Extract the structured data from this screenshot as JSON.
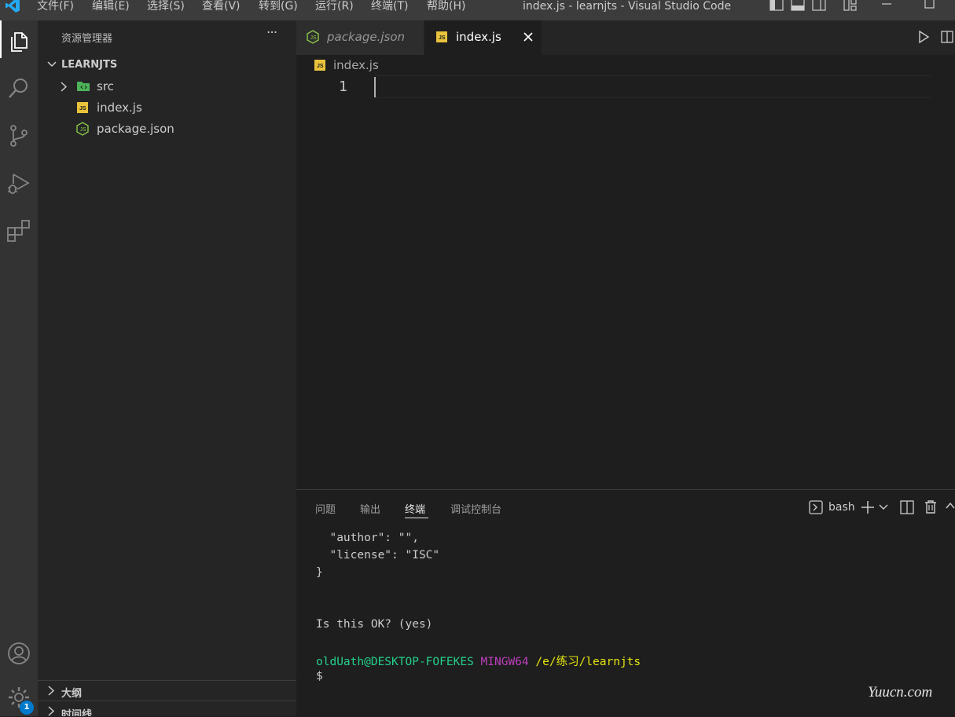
{
  "titlebar": {
    "menu": [
      "文件(F)",
      "编辑(E)",
      "选择(S)",
      "查看(V)",
      "转到(G)",
      "运行(R)",
      "终端(T)",
      "帮助(H)"
    ],
    "title": "index.js - learnjts - Visual Studio Code"
  },
  "activity_bar": {
    "items": [
      "explorer-icon",
      "search-icon",
      "source-control-icon",
      "run-debug-icon",
      "extensions-icon"
    ],
    "bottom": [
      "account-icon",
      "manage-gear-icon"
    ],
    "badge": "1"
  },
  "sidebar": {
    "title": "资源管理器",
    "more": "···",
    "root": "LEARNJTS",
    "items": [
      {
        "label": "src",
        "icon": "folder-icon"
      },
      {
        "label": "index.js",
        "icon": "js-file-icon"
      },
      {
        "label": "package.json",
        "icon": "node-json-icon"
      }
    ],
    "outline": "大纲",
    "timeline": "时间线"
  },
  "editor": {
    "tabs": [
      {
        "label": "package.json",
        "active": false
      },
      {
        "label": "index.js",
        "active": true
      }
    ],
    "breadcrumb": "index.js",
    "line_number": "1"
  },
  "panel": {
    "tabs": [
      "问题",
      "输出",
      "终端",
      "调试控制台"
    ],
    "active_tab": "终端",
    "shell": "bash",
    "terminal": {
      "line1": "  \"author\": \"\",",
      "line2": "  \"license\": \"ISC\"",
      "line3": "}",
      "line4": "Is this OK? (yes)",
      "prompt_user": "oldUath@DESKTOP-FOFEKES",
      "prompt_env": "MINGW64",
      "prompt_path": "/e/练习/learnjts",
      "prompt_symbol": "$"
    }
  },
  "colors": {
    "accent": "#007acc",
    "js_yellow": "#e8c33b",
    "node_green": "#8cc84b",
    "folder_green": "#4db35a",
    "term_green": "#23d18b",
    "term_magenta": "#bc3fbc",
    "term_yellow": "#e5e510"
  },
  "watermark": "Yuucn.com"
}
